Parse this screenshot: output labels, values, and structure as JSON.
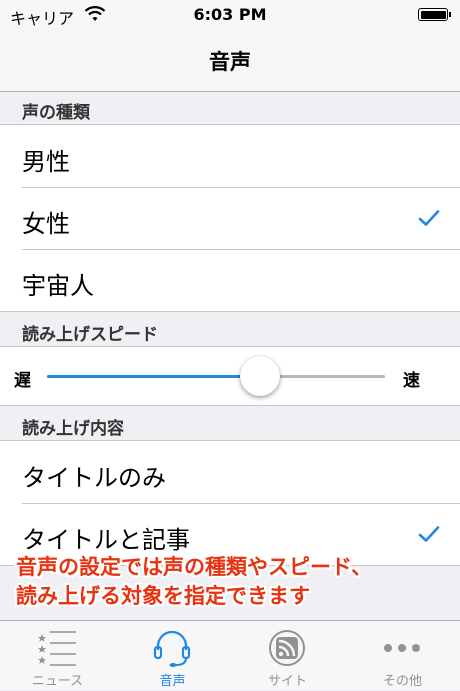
{
  "status_bar": {
    "carrier": "キャリア",
    "time": "6:03 PM"
  },
  "nav": {
    "title": "音声"
  },
  "voice_type": {
    "header": "声の種類",
    "options": [
      {
        "label": "男性",
        "selected": false
      },
      {
        "label": "女性",
        "selected": true
      },
      {
        "label": "宇宙人",
        "selected": false
      }
    ]
  },
  "speed": {
    "header": "読み上げスピード",
    "min_label": "遅",
    "max_label": "速",
    "value": 0.63
  },
  "content": {
    "header": "読み上げ内容",
    "options": [
      {
        "label": "タイトルのみ",
        "selected": false
      },
      {
        "label": "タイトルと記事",
        "selected": true
      }
    ]
  },
  "annotation": {
    "line1": "音声の設定では声の種類やスピード、",
    "line2": "読み上げる対象を指定できます"
  },
  "tabs": [
    {
      "label": "ニュース",
      "icon": "news-list-icon",
      "active": false
    },
    {
      "label": "音声",
      "icon": "headset-icon",
      "active": true
    },
    {
      "label": "サイト",
      "icon": "rss-icon",
      "active": false
    },
    {
      "label": "その他",
      "icon": "more-icon",
      "active": false
    }
  ],
  "colors": {
    "accent": "#1e88e5",
    "annotation": "#e63312",
    "inactive": "#929292"
  }
}
